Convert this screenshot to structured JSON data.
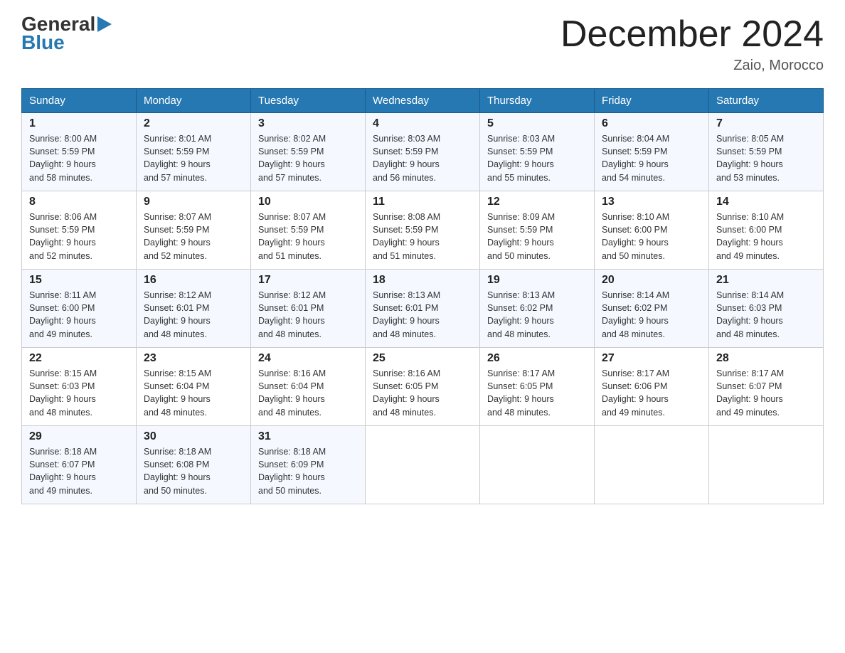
{
  "header": {
    "logo_general": "General",
    "logo_blue": "Blue",
    "title": "December 2024",
    "subtitle": "Zaio, Morocco"
  },
  "days_of_week": [
    "Sunday",
    "Monday",
    "Tuesday",
    "Wednesday",
    "Thursday",
    "Friday",
    "Saturday"
  ],
  "weeks": [
    [
      {
        "day": "1",
        "sunrise": "8:00 AM",
        "sunset": "5:59 PM",
        "daylight": "9 hours and 58 minutes."
      },
      {
        "day": "2",
        "sunrise": "8:01 AM",
        "sunset": "5:59 PM",
        "daylight": "9 hours and 57 minutes."
      },
      {
        "day": "3",
        "sunrise": "8:02 AM",
        "sunset": "5:59 PM",
        "daylight": "9 hours and 57 minutes."
      },
      {
        "day": "4",
        "sunrise": "8:03 AM",
        "sunset": "5:59 PM",
        "daylight": "9 hours and 56 minutes."
      },
      {
        "day": "5",
        "sunrise": "8:03 AM",
        "sunset": "5:59 PM",
        "daylight": "9 hours and 55 minutes."
      },
      {
        "day": "6",
        "sunrise": "8:04 AM",
        "sunset": "5:59 PM",
        "daylight": "9 hours and 54 minutes."
      },
      {
        "day": "7",
        "sunrise": "8:05 AM",
        "sunset": "5:59 PM",
        "daylight": "9 hours and 53 minutes."
      }
    ],
    [
      {
        "day": "8",
        "sunrise": "8:06 AM",
        "sunset": "5:59 PM",
        "daylight": "9 hours and 52 minutes."
      },
      {
        "day": "9",
        "sunrise": "8:07 AM",
        "sunset": "5:59 PM",
        "daylight": "9 hours and 52 minutes."
      },
      {
        "day": "10",
        "sunrise": "8:07 AM",
        "sunset": "5:59 PM",
        "daylight": "9 hours and 51 minutes."
      },
      {
        "day": "11",
        "sunrise": "8:08 AM",
        "sunset": "5:59 PM",
        "daylight": "9 hours and 51 minutes."
      },
      {
        "day": "12",
        "sunrise": "8:09 AM",
        "sunset": "5:59 PM",
        "daylight": "9 hours and 50 minutes."
      },
      {
        "day": "13",
        "sunrise": "8:10 AM",
        "sunset": "6:00 PM",
        "daylight": "9 hours and 50 minutes."
      },
      {
        "day": "14",
        "sunrise": "8:10 AM",
        "sunset": "6:00 PM",
        "daylight": "9 hours and 49 minutes."
      }
    ],
    [
      {
        "day": "15",
        "sunrise": "8:11 AM",
        "sunset": "6:00 PM",
        "daylight": "9 hours and 49 minutes."
      },
      {
        "day": "16",
        "sunrise": "8:12 AM",
        "sunset": "6:01 PM",
        "daylight": "9 hours and 48 minutes."
      },
      {
        "day": "17",
        "sunrise": "8:12 AM",
        "sunset": "6:01 PM",
        "daylight": "9 hours and 48 minutes."
      },
      {
        "day": "18",
        "sunrise": "8:13 AM",
        "sunset": "6:01 PM",
        "daylight": "9 hours and 48 minutes."
      },
      {
        "day": "19",
        "sunrise": "8:13 AM",
        "sunset": "6:02 PM",
        "daylight": "9 hours and 48 minutes."
      },
      {
        "day": "20",
        "sunrise": "8:14 AM",
        "sunset": "6:02 PM",
        "daylight": "9 hours and 48 minutes."
      },
      {
        "day": "21",
        "sunrise": "8:14 AM",
        "sunset": "6:03 PM",
        "daylight": "9 hours and 48 minutes."
      }
    ],
    [
      {
        "day": "22",
        "sunrise": "8:15 AM",
        "sunset": "6:03 PM",
        "daylight": "9 hours and 48 minutes."
      },
      {
        "day": "23",
        "sunrise": "8:15 AM",
        "sunset": "6:04 PM",
        "daylight": "9 hours and 48 minutes."
      },
      {
        "day": "24",
        "sunrise": "8:16 AM",
        "sunset": "6:04 PM",
        "daylight": "9 hours and 48 minutes."
      },
      {
        "day": "25",
        "sunrise": "8:16 AM",
        "sunset": "6:05 PM",
        "daylight": "9 hours and 48 minutes."
      },
      {
        "day": "26",
        "sunrise": "8:17 AM",
        "sunset": "6:05 PM",
        "daylight": "9 hours and 48 minutes."
      },
      {
        "day": "27",
        "sunrise": "8:17 AM",
        "sunset": "6:06 PM",
        "daylight": "9 hours and 49 minutes."
      },
      {
        "day": "28",
        "sunrise": "8:17 AM",
        "sunset": "6:07 PM",
        "daylight": "9 hours and 49 minutes."
      }
    ],
    [
      {
        "day": "29",
        "sunrise": "8:18 AM",
        "sunset": "6:07 PM",
        "daylight": "9 hours and 49 minutes."
      },
      {
        "day": "30",
        "sunrise": "8:18 AM",
        "sunset": "6:08 PM",
        "daylight": "9 hours and 50 minutes."
      },
      {
        "day": "31",
        "sunrise": "8:18 AM",
        "sunset": "6:09 PM",
        "daylight": "9 hours and 50 minutes."
      },
      null,
      null,
      null,
      null
    ]
  ],
  "labels": {
    "sunrise": "Sunrise: ",
    "sunset": "Sunset: ",
    "daylight": "Daylight: "
  }
}
